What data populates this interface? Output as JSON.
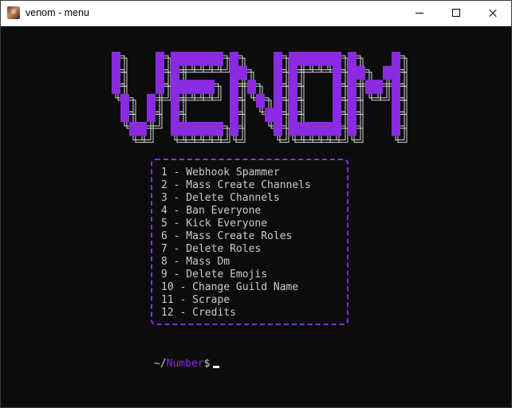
{
  "window": {
    "title": "venom - menu",
    "app_icon": "user-avatar-icon"
  },
  "controls": {
    "minimize_icon": "minimize-icon",
    "maximize_icon": "maximize-icon",
    "close_icon": "close-icon"
  },
  "logo": {
    "text": "VENOM",
    "color": "#8a2be2",
    "outline_color": "#d8d8d8"
  },
  "menu": {
    "border_color": "#8a2be2",
    "items": [
      "1 - Webhook Spammer",
      "2 - Mass Create Channels",
      "3 - Delete Channels",
      "4 - Ban Everyone",
      "5 - Kick Everyone",
      "6 - Mass Create Roles",
      "7 - Delete Roles",
      "8 - Mass Dm",
      "9 - Delete Emojis",
      "10 - Change Guild Name",
      "11 - Scrape",
      "12 - Credits"
    ]
  },
  "prompt": {
    "prefix": "~/",
    "word": "Number",
    "suffix": "$",
    "word_color": "#8a2be2"
  }
}
